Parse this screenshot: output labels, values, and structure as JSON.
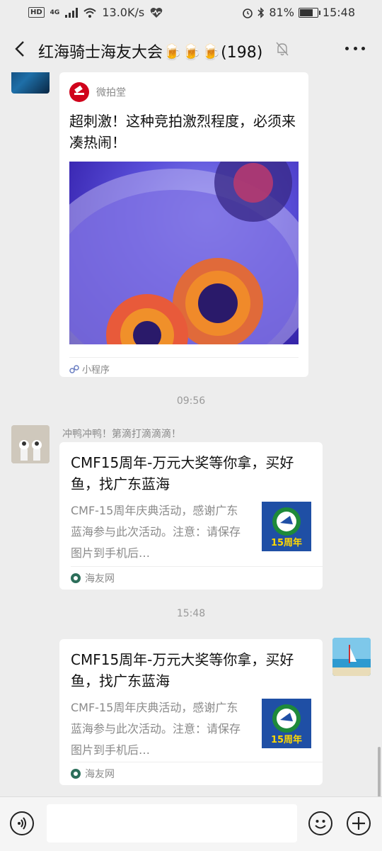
{
  "status": {
    "hd": "HD",
    "net": "4G",
    "speed": "13.0K/s",
    "battery": "81%",
    "battery_level": 0.81,
    "time": "15:48"
  },
  "header": {
    "title": "红海骑士海友大会🍺🍺🍺(198)",
    "icons": [
      "back-icon",
      "mute-bell-icon",
      "more-icon"
    ]
  },
  "messages": [
    {
      "type": "mini_program",
      "source": "微拍堂",
      "title": "超刺激！这种竞拍激烈程度，必须来凑热闹！",
      "footer": "小程序"
    },
    {
      "type": "timestamp",
      "text": "09:56"
    },
    {
      "type": "link",
      "sender": "冲鸭冲鸭！第滴打滴滴滴！",
      "title": "CMF15周年-万元大奖等你拿，买好鱼，找广东蓝海",
      "desc": "CMF-15周年庆典活动，感谢广东蓝海参与此次活动。注意：请保存图片到手机后…",
      "source": "海友网",
      "thumb_text": "15周年"
    },
    {
      "type": "timestamp",
      "text": "15:48"
    },
    {
      "type": "link",
      "title": "CMF15周年-万元大奖等你拿，买好鱼，找广东蓝海",
      "desc": "CMF-15周年庆典活动，感谢广东蓝海参与此次活动。注意：请保存图片到手机后…",
      "source": "海友网",
      "thumb_text": "15周年"
    }
  ],
  "input": {
    "icons": [
      "voice-icon",
      "emoji-icon",
      "plus-icon"
    ]
  }
}
